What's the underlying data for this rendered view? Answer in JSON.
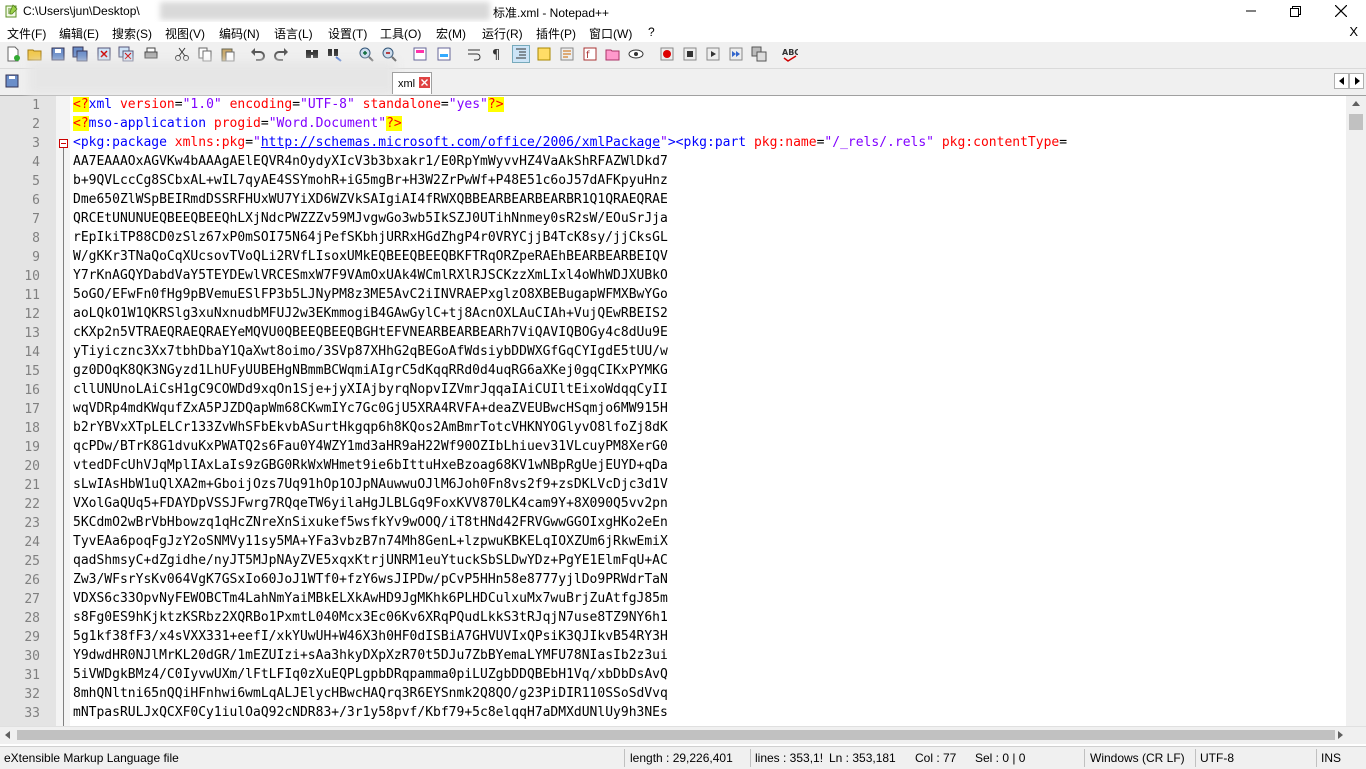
{
  "window": {
    "title_prefix": "C:\\Users\\jun\\Desktop\\",
    "title_suffix": "标准.xml - Notepad++"
  },
  "menu": [
    "文件(F)",
    "编辑(E)",
    "搜索(S)",
    "视图(V)",
    "编码(N)",
    "语言(L)",
    "设置(T)",
    "工具(O)",
    "宏(M)",
    "运行(R)",
    "插件(P)",
    "窗口(W)",
    "?"
  ],
  "menu_close": "X",
  "tab": {
    "label": "xml"
  },
  "lines": [
    {
      "n": "1"
    },
    {
      "n": "2"
    },
    {
      "n": "3"
    },
    {
      "n": "4",
      "t": "AA7EAAAOxAGVKw4bAAAgAElEQVR4nOydyXIcV3b3bxakr1/E0RpYmWyvvHZ4VaAkShRFAZWlDkd7"
    },
    {
      "n": "5",
      "t": "b+9QVLccCg8SCbxAL+wIL7qyAE4SSYmohR+iG5mgBr+H3W2ZrPwWf+P48E51c6oJ57dAFKpyuHnz"
    },
    {
      "n": "6",
      "t": "Dme650ZlWSpBEIRmdDSSRFHUxWU7YiXD6WZVkSAIgiAI4fRWXQBBEARBEARBEARBR1Q1QRAEQRAE"
    },
    {
      "n": "7",
      "t": "QRCEtUNUNUEQBEEQBEEQhLXjNdcPWZZZv59MJvgwGo3wb5IkSZJ0UTihNnmey0sR2sW/EOuSrJja"
    },
    {
      "n": "8",
      "t": "rEpIkiTP88CD0zSlz67xP0mSOI75N64jPefSKbhjURRxHGdZhgP4r0VRYCjjB4TcK8sy/jjCksGL"
    },
    {
      "n": "9",
      "t": "W/gKKr3TNaQoCqXUcsovTVoQLi2RVfLIsoxUMkEQBEEQBEEQBKFTRqORZpeRAEhBEARBEARBEIQV"
    },
    {
      "n": "10",
      "t": "Y7rKnAGQYDabdVaY5TEYDEwlVRCESmxW7F9VAmOxUAk4WCmlRXlRJSCKzzXmLIxl4oWhWDJXUBkO"
    },
    {
      "n": "11",
      "t": "5oGO/EFwFn0fHg9pBVemuESlFP3b5LJNyPM8z3ME5AvC2iINVRAEPxglzO8XBEBugapWFMXBwYGo"
    },
    {
      "n": "12",
      "t": "aoLQkO1W1QKRSlg3xuNxnudbMFUJ2w3EKmmogiB4GAwGylC+tj8AcnOXLAuCIAh+VujQEwRBEIS2"
    },
    {
      "n": "13",
      "t": "cKXp2n5VTRAEQRAEQRAEYeMQVU0QBEEQBEEQBGHtEFVNEARBEARBEARh7ViQAVIQBOGy4c8dUu9E"
    },
    {
      "n": "14",
      "t": "yTiyicznc3Xx7tbhDbaY1QaXwt8oimo/3SVp87XHhG2qBEGoAfWdsiybDDWXGfGqCYIgdE5tUU/w"
    },
    {
      "n": "15",
      "t": "gz0DOqK8QK3NGyzd1LhUFyUUBEHgNBmmBCWqmiAIgrC5dKqqRRd0d4uqRG6aXKej0gqCIKxPYMKG"
    },
    {
      "n": "16",
      "t": "cllUNUnoLAiCsH1gC9COWDd9xqOn1Sje+jyXIAjbyrqNopvIZVmrJqqaIAiCUIltEixoWdqqCyII"
    },
    {
      "n": "17",
      "t": "wqVDRp4mdKWqufZxA5PJZDQapWm68CKwmIYc7Gc0GjU5XRA4RVFA+deaZVEUBwcHSqmjo6MW915H"
    },
    {
      "n": "18",
      "t": "b2rYBVxXTpLELCr133ZvWhSFbEkvbASurtHkgqp6h8KQos2AmBmrTotcVHKNYOGlyvO8lfoZj8dK"
    },
    {
      "n": "19",
      "t": "qcPDw/BTrK8G1dvuKxPWATQ2s6Fau0Y4WZY1md3aHR9aH22Wf90OZIbLhiuev31VLcuyPM8XerG0"
    },
    {
      "n": "20",
      "t": "vtedDFcUhVJqMplIAxLaIs9zGBG0RkWxWHmet9ie6bIttuHxeBzoag68KV1wNBpRgUejEUYD+qDa"
    },
    {
      "n": "21",
      "t": "sLwIAsHbW1uQlXA2m+GboijOzs7Uq91hOp1OJpNAuwwuOJlM6Joh0Fn8vs2f9+zsDKLVcDjc3d1V"
    },
    {
      "n": "22",
      "t": "VXolGaQUq5+FDAYDpVSSJFwrg7RQqeTW6yilaHgJLBLGq9FoxKVV870LK4cam9Y+8X090Q5vv2pn"
    },
    {
      "n": "23",
      "t": "5KCdmO2wBrVbHbowzq1qHcZNreXnSixukef5wsfkYv9wOOQ/iT8tHNd42FRVGwwGGOIxgHKo2eEn"
    },
    {
      "n": "24",
      "t": "TyvEAa6poqFgJzY2oSNMVy11sy5MA+YFa3vbzB7n74Mh8GenL+lzpwuKBKELqIOXZUm6jRkwEmiX"
    },
    {
      "n": "25",
      "t": "qadShmsyC+dZgidhe/nyJT5MJpNAyZVE5xqxKtrjUNRM1euYtuckSbSLDwYDz+PgYE1ElmFqU+AC"
    },
    {
      "n": "26",
      "t": "Zw3/WFsrYsKv064VgK7GSxIo60JoJ1WTf0+fzY6wsJIPDw/pCvP5HHn58e8777yjlDo9PRWdrTaN"
    },
    {
      "n": "27",
      "t": "VDXS6c33OpvNyFEWOBCTm4LahNmYaiMBkELXkAwHD9JgMKhk6PLHDCulxuMx7wuBrjZuAtfgJ85m"
    },
    {
      "n": "28",
      "t": "s8Fg0ES9hKjktzKSRbz2XQRBo1PxmtL040Mcx3Ec06Kv6XRqPQudLkkS3tRJqjN7use8TZ9NY6h1"
    },
    {
      "n": "29",
      "t": "5g1kf38fF3/x4sVXX331+eefI/xkYUwUH+W46X3h0HF0dISBiA7GHVUVIxQPsiK3QJIkvB54RY3H"
    },
    {
      "n": "30",
      "t": "Y9dwdHR0NJlMrKL20dGR/1mEZUIzi+sAa3hkyDXpXzR70t5DJu7ZbBYemaLYMFU78NIasIb2z3ui"
    },
    {
      "n": "31",
      "t": "5iVWDgkBMz4/C0IyvwUXm/lFtLFIq0zXuEQPLgpbDRqpamma0piLUZgbDDQBEbH1Vq/xbDbDsAvQ"
    },
    {
      "n": "32",
      "t": "8mhQNltni65nQQiHFnhwi6wmLqALJElycHBwcHAQrq3R6EYSnmk2Q8QO/g23PiDIR110SSoSdVvq"
    },
    {
      "n": "33",
      "t": "mNTpasRULJxQCXF0Cy1iulOaQ92cNDR83+/3r1y58pvf/Kbf79+5c8elqqH7aDMXdUNlUy9h3NEs"
    }
  ],
  "line1": {
    "p1": "<?",
    "tag": "xml",
    "a1": "version",
    "e1": "=",
    "v1": "\"1.0\"",
    "a2": "encoding",
    "e2": "=",
    "v2": "\"UTF-8\"",
    "a3": "standalone",
    "e3": "=",
    "v3": "\"yes\"",
    "p2": "?>"
  },
  "line2": {
    "p1": "<?",
    "tag": "mso-application",
    "a1": "progid",
    "e1": "=",
    "v1": "\"Word.Document\"",
    "p2": "?>"
  },
  "line3": {
    "tag1": "<pkg:package",
    "a1": "xmlns:pkg",
    "e1": "=",
    "q1": "\"",
    "url": "http://schemas.microsoft.com/office/2006/xmlPackage",
    "q2": "\"",
    "tag2": "><pkg:part",
    "a2": "pkg:name",
    "e2": "=",
    "v2": "\"/_rels/.rels\"",
    "a3": "pkg:contentType",
    "e3": "="
  },
  "status": {
    "file_type": "eXtensible Markup Language file",
    "length": "length : 29,226,401",
    "lines": "lines : 353,1!",
    "ln": "Ln : 353,181",
    "col": "Col : 77",
    "sel": "Sel : 0 | 0",
    "eol": "Windows (CR LF)",
    "encoding": "UTF-8",
    "mode": "INS"
  }
}
